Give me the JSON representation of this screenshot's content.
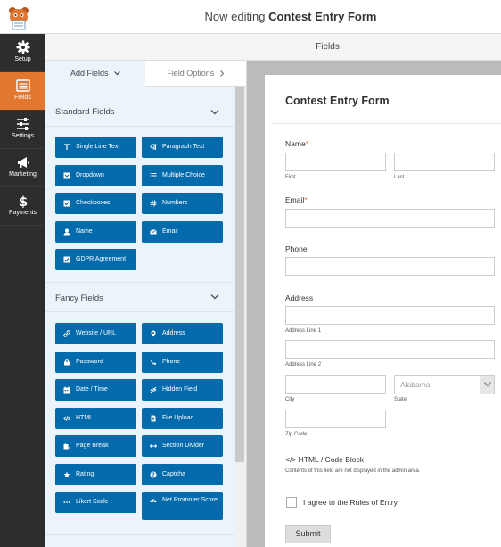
{
  "header": {
    "editing_prefix": "Now editing",
    "form_name": "Contest Entry Form"
  },
  "sidebar": {
    "items": [
      {
        "label": "Setup",
        "icon": "gear-icon"
      },
      {
        "label": "Fields",
        "icon": "fields-icon",
        "active": true
      },
      {
        "label": "Settings",
        "icon": "sliders-icon"
      },
      {
        "label": "Marketing",
        "icon": "megaphone-icon"
      },
      {
        "label": "Payments",
        "icon": "dollar-icon"
      }
    ]
  },
  "fields_header": {
    "title": "Fields"
  },
  "tabs": {
    "add_fields": "Add Fields",
    "field_options": "Field Options"
  },
  "standard_fields": {
    "title": "Standard Fields",
    "buttons": [
      {
        "label": "Single Line Text",
        "icon": "text-icon"
      },
      {
        "label": "Paragraph Text",
        "icon": "paragraph-icon"
      },
      {
        "label": "Dropdown",
        "icon": "dropdown-icon"
      },
      {
        "label": "Multiple Choice",
        "icon": "list-icon"
      },
      {
        "label": "Checkboxes",
        "icon": "checkbox-icon"
      },
      {
        "label": "Numbers",
        "icon": "hash-icon"
      },
      {
        "label": "Name",
        "icon": "user-icon"
      },
      {
        "label": "Email",
        "icon": "envelope-icon"
      },
      {
        "label": "GDPR Agreement",
        "icon": "checkbox-icon"
      }
    ]
  },
  "fancy_fields": {
    "title": "Fancy Fields",
    "buttons": [
      {
        "label": "Website / URL",
        "icon": "link-icon"
      },
      {
        "label": "Address",
        "icon": "map-marker-icon"
      },
      {
        "label": "Password",
        "icon": "lock-icon"
      },
      {
        "label": "Phone",
        "icon": "phone-icon"
      },
      {
        "label": "Date / Time",
        "icon": "calendar-icon"
      },
      {
        "label": "Hidden Field",
        "icon": "eye-slash-icon"
      },
      {
        "label": "HTML",
        "icon": "code-icon"
      },
      {
        "label": "File Upload",
        "icon": "upload-icon"
      },
      {
        "label": "Page Break",
        "icon": "copy-icon"
      },
      {
        "label": "Section Divider",
        "icon": "arrows-h-icon"
      },
      {
        "label": "Rating",
        "icon": "star-icon"
      },
      {
        "label": "Captcha",
        "icon": "question-icon"
      },
      {
        "label": "Likert Scale",
        "icon": "ellipsis-icon"
      },
      {
        "label": "Net Promoter Score",
        "icon": "tachometer-icon"
      }
    ]
  },
  "form": {
    "title": "Contest Entry Form",
    "name_label": "Name",
    "required_mark": "*",
    "name_first": "First",
    "name_last": "Last",
    "email_label": "Email",
    "phone_label": "Phone",
    "address_label": "Address",
    "address_line1": "Address Line 1",
    "address_line2": "Address Line 2",
    "city": "City",
    "state": "State",
    "state_value": "Alabama",
    "zip": "Zip Code",
    "html_block_title": "</> HTML / Code Block",
    "html_block_note": "Contents of this field are not displayed in the admin area.",
    "agree_label": "I agree to the Rules of Entry.",
    "submit_label": "Submit"
  },
  "colors": {
    "accent": "#e27730",
    "button_blue": "#036aab",
    "sidebar_bg": "#2d2d2d",
    "panel_bg": "#ebf3fb"
  }
}
